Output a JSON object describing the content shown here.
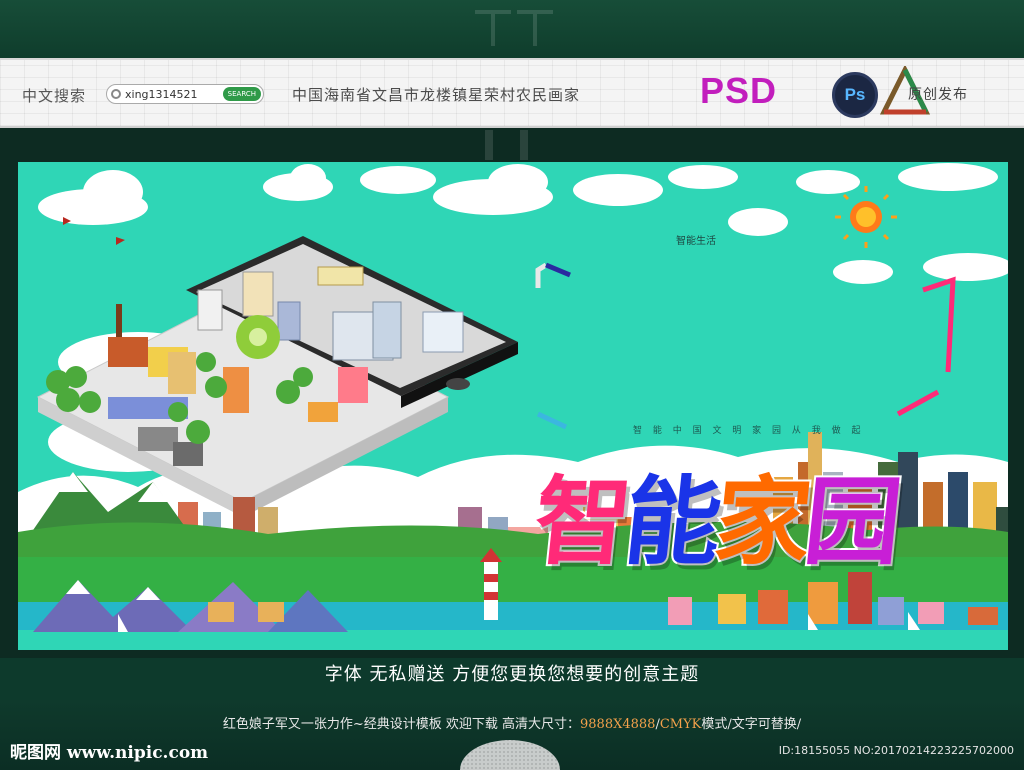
{
  "header": {
    "search_label": "中文搜索",
    "search_value": "xing1314521",
    "search_button": "SEARCH",
    "slogan": "中国海南省文昌市龙楼镇星荣村农民画家",
    "psd_badge": "PSD",
    "ps_icon_text": "Ps",
    "original_label": "原创发布"
  },
  "banner": {
    "title_chars": [
      "智",
      "能",
      "家",
      "园"
    ],
    "subtitle": "智 能 中 国 文 明 家 园 从 我 做 起",
    "small_tag": "智能生活"
  },
  "caption": "字体 无私赠送 方便您更换您想要的创意主题",
  "footer": {
    "line_part1": "红色娘子军又一张力作~经典设计模板   欢迎下载 高清大尺寸：",
    "line_accent1": "9888X4888",
    "line_sep": "/",
    "line_accent2": "CMYK",
    "line_part2": "模式/文字可替换/",
    "site": "昵图网 www.nipic.com",
    "id_text": "ID:18155055 NO:20170214223225702000"
  },
  "colors": {
    "banner_bg": "#2fd6b6",
    "title_pink": "#ff2a78",
    "title_blue": "#1a34e8",
    "title_orange": "#ff6a00",
    "title_purple": "#c81fd6",
    "psd_magenta": "#c21ebd"
  },
  "icons": [
    "search-icon",
    "photoshop-icon",
    "original-triangle-icon",
    "sun-icon"
  ]
}
